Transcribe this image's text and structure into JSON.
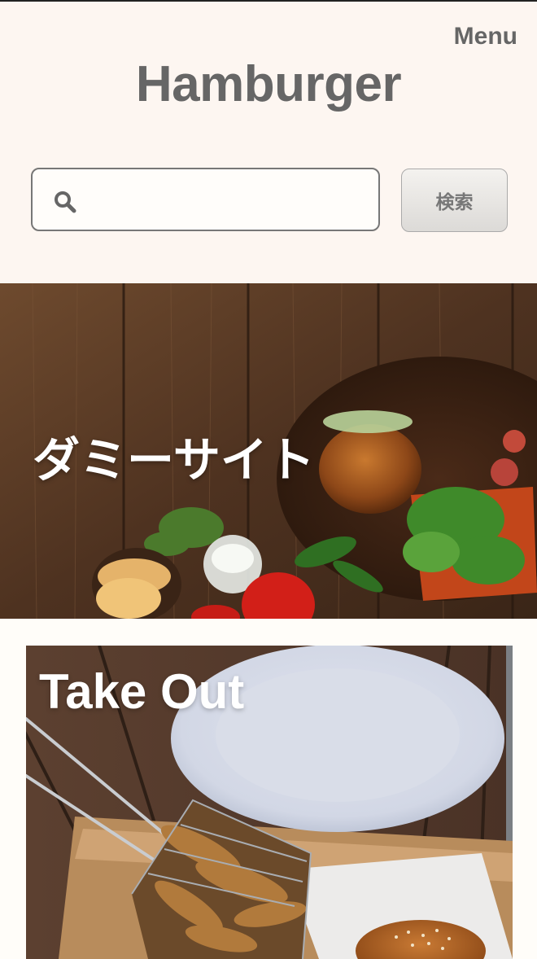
{
  "header": {
    "menu_label": "Menu",
    "title": "Hamburger"
  },
  "search": {
    "placeholder": "",
    "value": "",
    "button_label": "検索",
    "icon": "search-icon"
  },
  "hero": {
    "text": "ダミーサイト"
  },
  "card": {
    "title": "Take Out"
  },
  "colors": {
    "header_bg": "#fdf6f1",
    "page_bg": "#fffdf9",
    "title_text": "#666666",
    "wood": "#5a3a22",
    "plate": "#d7dce8"
  }
}
